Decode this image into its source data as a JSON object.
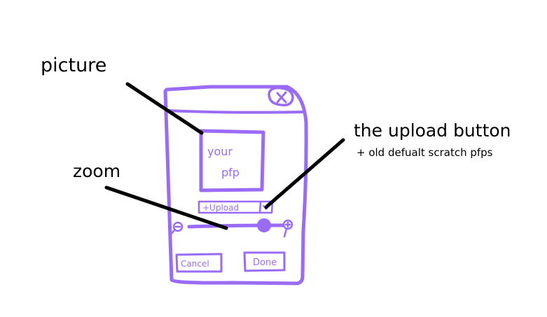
{
  "annotations": {
    "picture": "picture",
    "zoom": "zoom",
    "upload_button": "the upload button",
    "upload_button_note": "+ old defualt scratch pfps"
  },
  "dialog": {
    "picture_text_line1": "your",
    "picture_text_line2": "pfp",
    "upload_label": "+Upload",
    "cancel_label": "Cancel",
    "done_label": "Done",
    "close_symbol": "×"
  },
  "colors": {
    "sketch": "#9a6cf5",
    "pointer_lines": "#000000",
    "background": "#ffffff"
  },
  "icons": [
    "close-icon",
    "zoom-out-icon",
    "zoom-in-icon",
    "dropdown-icon"
  ]
}
